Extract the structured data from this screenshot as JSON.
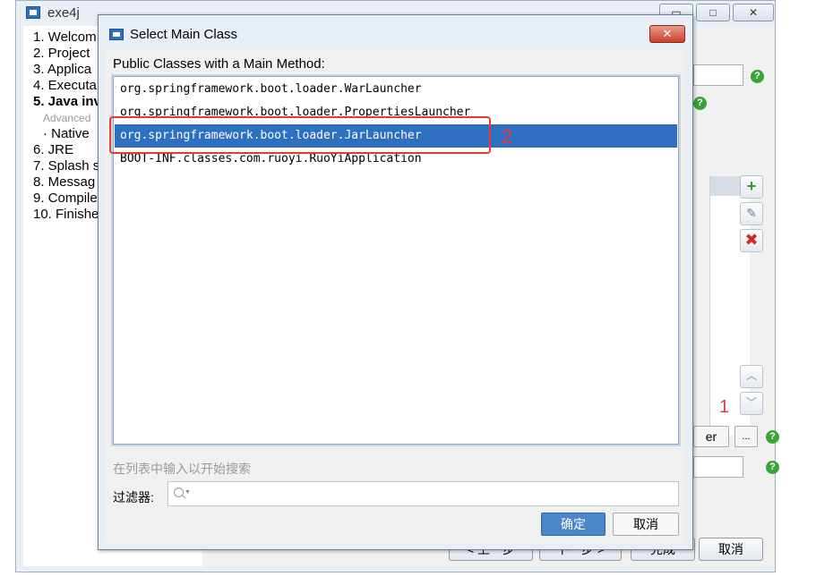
{
  "main_window": {
    "title": "exe4j",
    "min_glyph": "▭",
    "max_glyph": "□",
    "close_glyph": "✕",
    "steps": [
      "1. Welcom",
      "2. Project",
      "3. Applica",
      "4. Executa",
      "5. Java inv",
      "Advanced",
      "· Native",
      "6. JRE",
      "7. Splash s",
      "8. Messag",
      "9. Compile",
      "10. Finishe"
    ],
    "help_glyph": "?",
    "add_glyph": "+",
    "edit_glyph": "✎",
    "delete_glyph": "✖",
    "up_glyph": "︿",
    "down_glyph": "﹀",
    "browse_partial_label": "er",
    "ellipsis_label": "...",
    "back_label": "< 上一步",
    "next_label": "下一步 >",
    "finish_label": "完成",
    "cancel_label": "取消"
  },
  "dialog": {
    "title": "Select Main Class",
    "close_glyph": "✕",
    "list_label": "Public Classes with a Main Method:",
    "classes": [
      "org.springframework.boot.loader.WarLauncher",
      "org.springframework.boot.loader.PropertiesLauncher",
      "org.springframework.boot.loader.JarLauncher",
      "BOOT-INF.classes.com.ruoyi.RuoYiApplication"
    ],
    "selected_index": 2,
    "search_hint": "在列表中输入以开始搜索",
    "filter_label": "过滤器:",
    "filter_value": "",
    "ok_label": "确定",
    "cancel_label": "取消"
  },
  "annotations": {
    "marker_1": "1",
    "marker_2": "2",
    "color": "#e53935"
  },
  "colors": {
    "selection": "#2e6fc0",
    "ok_button": "#4a86c8",
    "close_button": "#c9412b"
  }
}
